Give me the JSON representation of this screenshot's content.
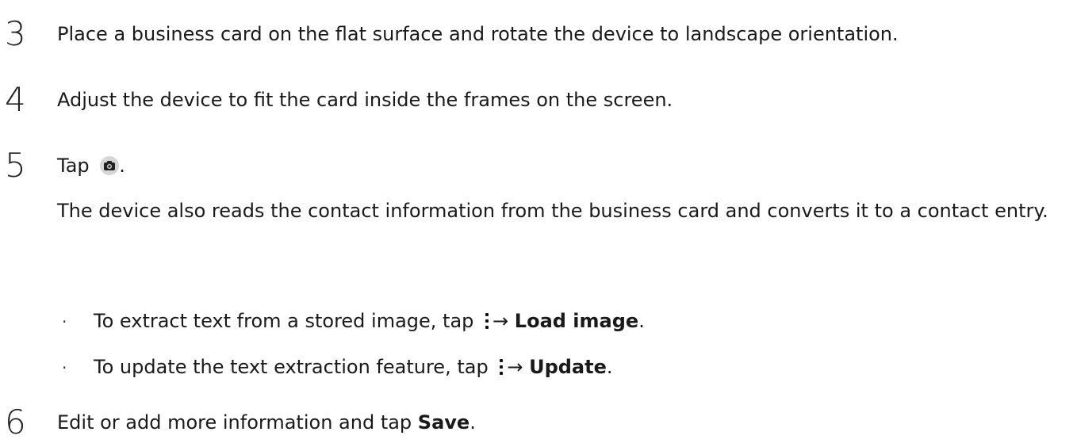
{
  "steps": [
    {
      "num": "3",
      "text": "Place a business card on the flat surface and rotate the device to landscape orientation."
    },
    {
      "num": "4",
      "text": "Adjust the device to fit the card inside the frames on the screen."
    },
    {
      "num": "5",
      "text_before": "Tap",
      "text_after": ".",
      "icon": "camera-icon"
    },
    {
      "num": "6",
      "text_before": "Edit or add more information and tap ",
      "bold": "Save",
      "text_after": "."
    }
  ],
  "step5_description": "The device also reads the contact information from the business card and converts it to a contact entry.",
  "bullets": [
    {
      "dot": "·",
      "text_before": "To extract text from a stored image, tap",
      "arrow": "→",
      "bold": "Load image",
      "text_after": ".",
      "icon": "more-options-icon"
    },
    {
      "dot": "·",
      "text_before": "To update the text extraction feature, tap",
      "arrow": "→",
      "bold": "Update",
      "text_after": ".",
      "icon": "more-options-icon"
    }
  ]
}
